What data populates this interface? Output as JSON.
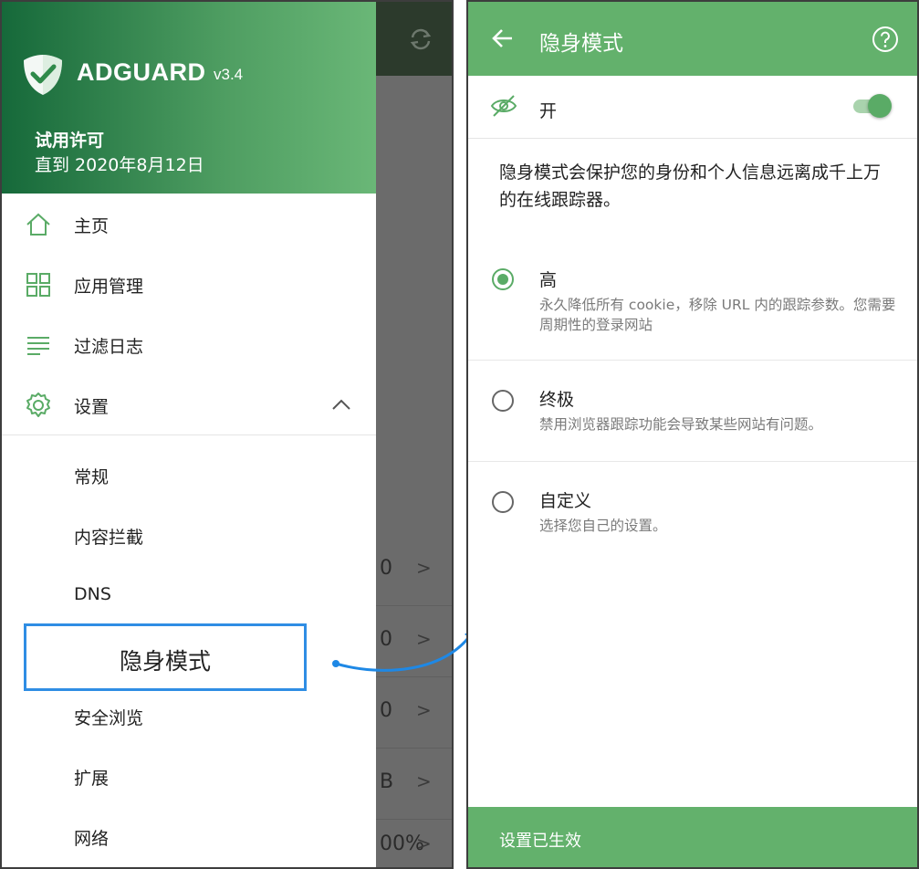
{
  "left": {
    "background_values": [
      {
        "value": "0",
        "chevron": ">"
      },
      {
        "value": "0",
        "chevron": ">"
      },
      {
        "value": "0",
        "chevron": ">"
      },
      {
        "value": "B",
        "chevron": ">"
      },
      {
        "value": "00%",
        "chevron": ">"
      }
    ],
    "drawer": {
      "brand": "ADGUARD",
      "version": "v3.4",
      "license_title": "试用许可",
      "license_until": "直到 2020年8月12日",
      "menu": [
        {
          "label": "主页",
          "icon": "home-icon"
        },
        {
          "label": "应用管理",
          "icon": "apps-grid-icon"
        },
        {
          "label": "过滤日志",
          "icon": "list-icon"
        },
        {
          "label": "设置",
          "icon": "gear-icon"
        }
      ],
      "settings_sub": [
        "常规",
        "内容拦截",
        "DNS",
        "隐身模式",
        "安全浏览",
        "扩展",
        "网络"
      ]
    }
  },
  "right": {
    "title": "隐身模式",
    "toggle_label": "开",
    "toggle_on": true,
    "description": "隐身模式会保护您的身份和个人信息远离成千上万的在线跟踪器。",
    "options": [
      {
        "title": "高",
        "desc": "永久降低所有 cookie，移除 URL 内的跟踪参数。您需要周期性的登录网站",
        "selected": true
      },
      {
        "title": "终极",
        "desc": "禁用浏览器跟踪功能会导致某些网站有问题。",
        "selected": false
      },
      {
        "title": "自定义",
        "desc": "选择您自己的设置。",
        "selected": false
      }
    ],
    "footer": "设置已生效"
  },
  "colors": {
    "accent": "#63b16c",
    "header_dark": "#16693a",
    "highlight_border": "#2f8de4",
    "arrow": "#1e88e5"
  }
}
